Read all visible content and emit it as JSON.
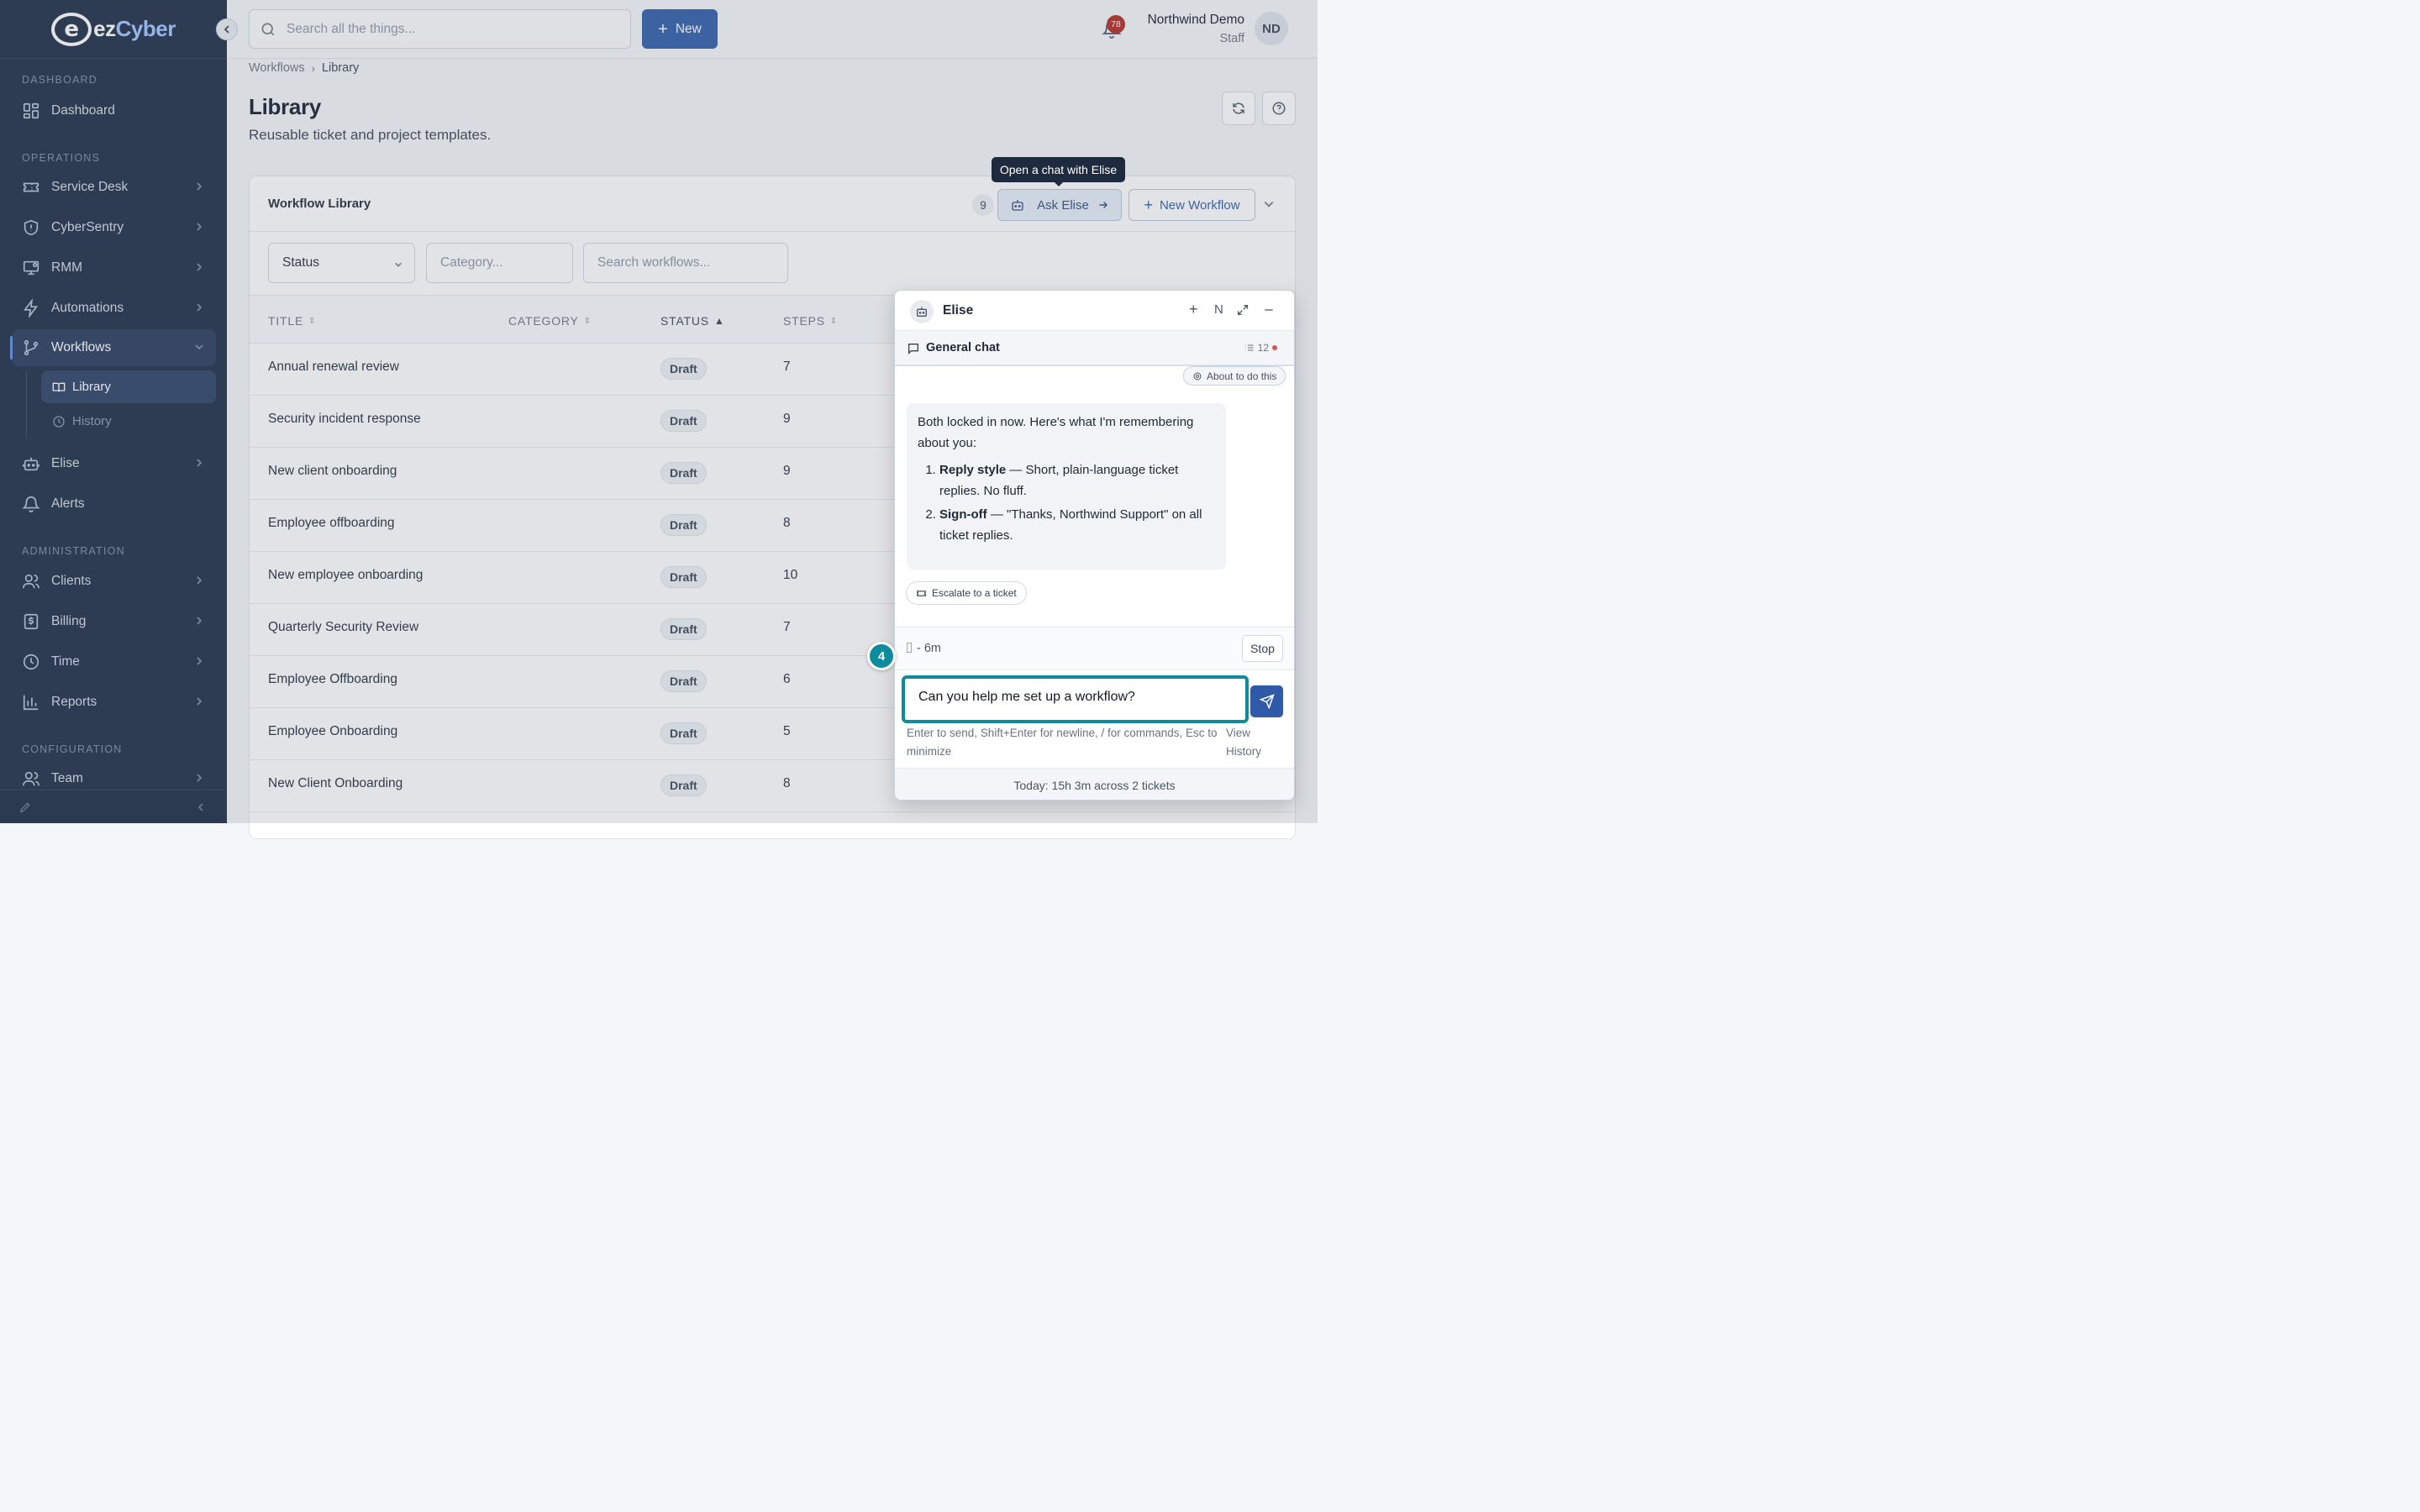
{
  "brand": {
    "logo_letter": "e",
    "name_left": "ez",
    "name_right": "Cyber"
  },
  "sidebar": {
    "sections": {
      "dashboard": "DASHBOARD",
      "operations": "OPERATIONS",
      "administration": "ADMINISTRATION",
      "configuration": "CONFIGURATION"
    },
    "items": {
      "dashboard": "Dashboard",
      "service_desk": "Service Desk",
      "cybersentry": "CyberSentry",
      "rmm": "RMM",
      "automations": "Automations",
      "workflows": "Workflows",
      "library": "Library",
      "history": "History",
      "elise": "Elise",
      "alerts": "Alerts",
      "clients": "Clients",
      "billing": "Billing",
      "time": "Time",
      "reports": "Reports",
      "team": "Team"
    }
  },
  "topbar": {
    "search_placeholder": "Search all the things...",
    "new_label": "New",
    "notification_count": "78",
    "user_name": "Northwind Demo",
    "user_role": "Staff",
    "avatar_initials": "ND"
  },
  "breadcrumb": {
    "parent": "Workflows",
    "current": "Library"
  },
  "page": {
    "title": "Library",
    "subtitle": "Reusable ticket and project templates."
  },
  "card": {
    "title": "Workflow Library",
    "count": "9",
    "ask_elise": "Ask Elise",
    "new_workflow": "New Workflow",
    "tooltip": "Open a chat with Elise"
  },
  "filters": {
    "status": "Status",
    "category_placeholder": "Category...",
    "search_placeholder": "Search workflows..."
  },
  "table": {
    "headers": {
      "title": "TITLE",
      "category": "CATEGORY",
      "status": "STATUS",
      "steps": "STEPS"
    },
    "rows": [
      {
        "title": "Annual renewal review",
        "status": "Draft",
        "steps": "7"
      },
      {
        "title": "Security incident response",
        "status": "Draft",
        "steps": "9"
      },
      {
        "title": "New client onboarding",
        "status": "Draft",
        "steps": "9"
      },
      {
        "title": "Employee offboarding",
        "status": "Draft",
        "steps": "8"
      },
      {
        "title": "New employee onboarding",
        "status": "Draft",
        "steps": "10"
      },
      {
        "title": "Quarterly Security Review",
        "status": "Draft",
        "steps": "7"
      },
      {
        "title": "Employee Offboarding",
        "status": "Draft",
        "steps": "6"
      },
      {
        "title": "Employee Onboarding",
        "status": "Draft",
        "steps": "5"
      },
      {
        "title": "New Client Onboarding",
        "status": "Draft",
        "steps": "8"
      }
    ]
  },
  "chat": {
    "name": "Elise",
    "ctl_new": "+",
    "ctl_n": "N",
    "thread": "General chat",
    "thread_count": "12",
    "about_chip": "About to do this",
    "message": {
      "intro": "Both locked in now. Here's what I'm remembering about you:",
      "items": [
        {
          "bold": "Reply style",
          "text": " — Short, plain-language ticket replies. No fluff."
        },
        {
          "bold": "Sign-off",
          "text": " — \"Thanks, Northwind Support\" on all ticket replies."
        }
      ]
    },
    "escalate": "Escalate to a ticket",
    "timer_text": "-  6m",
    "stop": "Stop",
    "input_value": "Can you help me set up a workflow?",
    "hint": "Enter to send, Shift+Enter for newline, / for commands, Esc to minimize",
    "view_history": "View History",
    "footer": "Today: 15h 3m across 2 tickets"
  },
  "step_badge": "4"
}
